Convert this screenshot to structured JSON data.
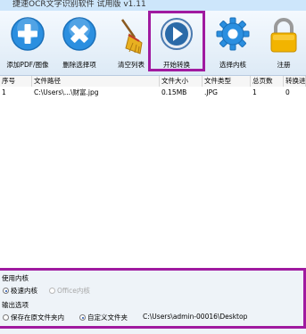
{
  "window": {
    "title": "捷速OCR文字识别软件 试用版 v1.11"
  },
  "toolbar": {
    "add_label": "添加PDF/图像",
    "delete_label": "删除选择项",
    "clear_label": "清空列表",
    "start_label": "开始转换",
    "settings_label": "选择内核",
    "register_label": "注册"
  },
  "table": {
    "headers": [
      "序号",
      "文件路径",
      "文件大小",
      "文件类型",
      "总页数",
      "转换进"
    ],
    "rows": [
      [
        "1",
        "C:\\Users\\...\\财富.jpg",
        "0.15MB",
        ".JPG",
        "1",
        "0"
      ]
    ]
  },
  "engine": {
    "section_label": "使用内核",
    "option_fast": "极速内核",
    "option_office": "Office内核",
    "selected": "option_fast"
  },
  "output": {
    "section_label": "输出选项",
    "option_same": "保存在原文件夹内",
    "option_custom": "自定义文件夹",
    "path_value": "C:\\Users\\admin-00016\\Desktop",
    "selected": "option_custom"
  },
  "colors": {
    "highlight": "#a01aa0",
    "add_icon": "#2b8fe0",
    "delete_icon": "#2b8fe0",
    "play_icon": "#2a6aa8",
    "gear_icon": "#2b8fe0",
    "lock_icon": "#f2b400"
  }
}
